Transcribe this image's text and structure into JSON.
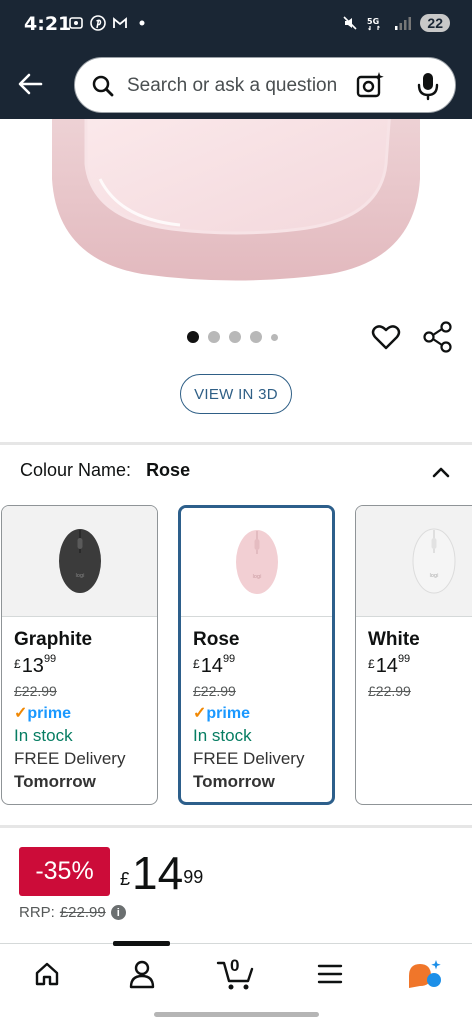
{
  "status_bar": {
    "time": "4:21",
    "battery": "22"
  },
  "header": {
    "search_placeholder": "Search or ask a question"
  },
  "product_actions": {
    "view_3d_label": "VIEW IN 3D"
  },
  "colour": {
    "label": "Colour Name:",
    "value": "Rose"
  },
  "variants": [
    {
      "name": "Graphite",
      "currency": "£",
      "whole": "13",
      "fraction": "99",
      "rrp": "£22.99",
      "prime": "prime",
      "stock": "In stock",
      "delivery": "FREE Delivery",
      "when": "Tomorrow",
      "colour": "#3b3b3b",
      "selected": false
    },
    {
      "name": "Rose",
      "currency": "£",
      "whole": "14",
      "fraction": "99",
      "rrp": "£22.99",
      "prime": "prime",
      "stock": "In stock",
      "delivery": "FREE Delivery",
      "when": "Tomorrow",
      "colour": "#f2cfd3",
      "selected": true
    },
    {
      "name": "White",
      "currency": "£",
      "whole": "14",
      "fraction": "99",
      "rrp": "£22.99",
      "colour": "#eeeeee",
      "selected": false
    }
  ],
  "price": {
    "discount": "-35%",
    "currency": "£",
    "whole": "14",
    "fraction": "99",
    "rrp_label": "RRP:",
    "rrp_value": "£22.99"
  },
  "bottom_nav": {
    "cart_count": "0"
  },
  "colors": {
    "header_bg": "#1a2634",
    "accent_blue": "#2d5f8b",
    "deal_red": "#cc0c39",
    "stock_green": "#067d62",
    "prime_blue": "#1a98ff",
    "prime_check": "#f08804"
  }
}
